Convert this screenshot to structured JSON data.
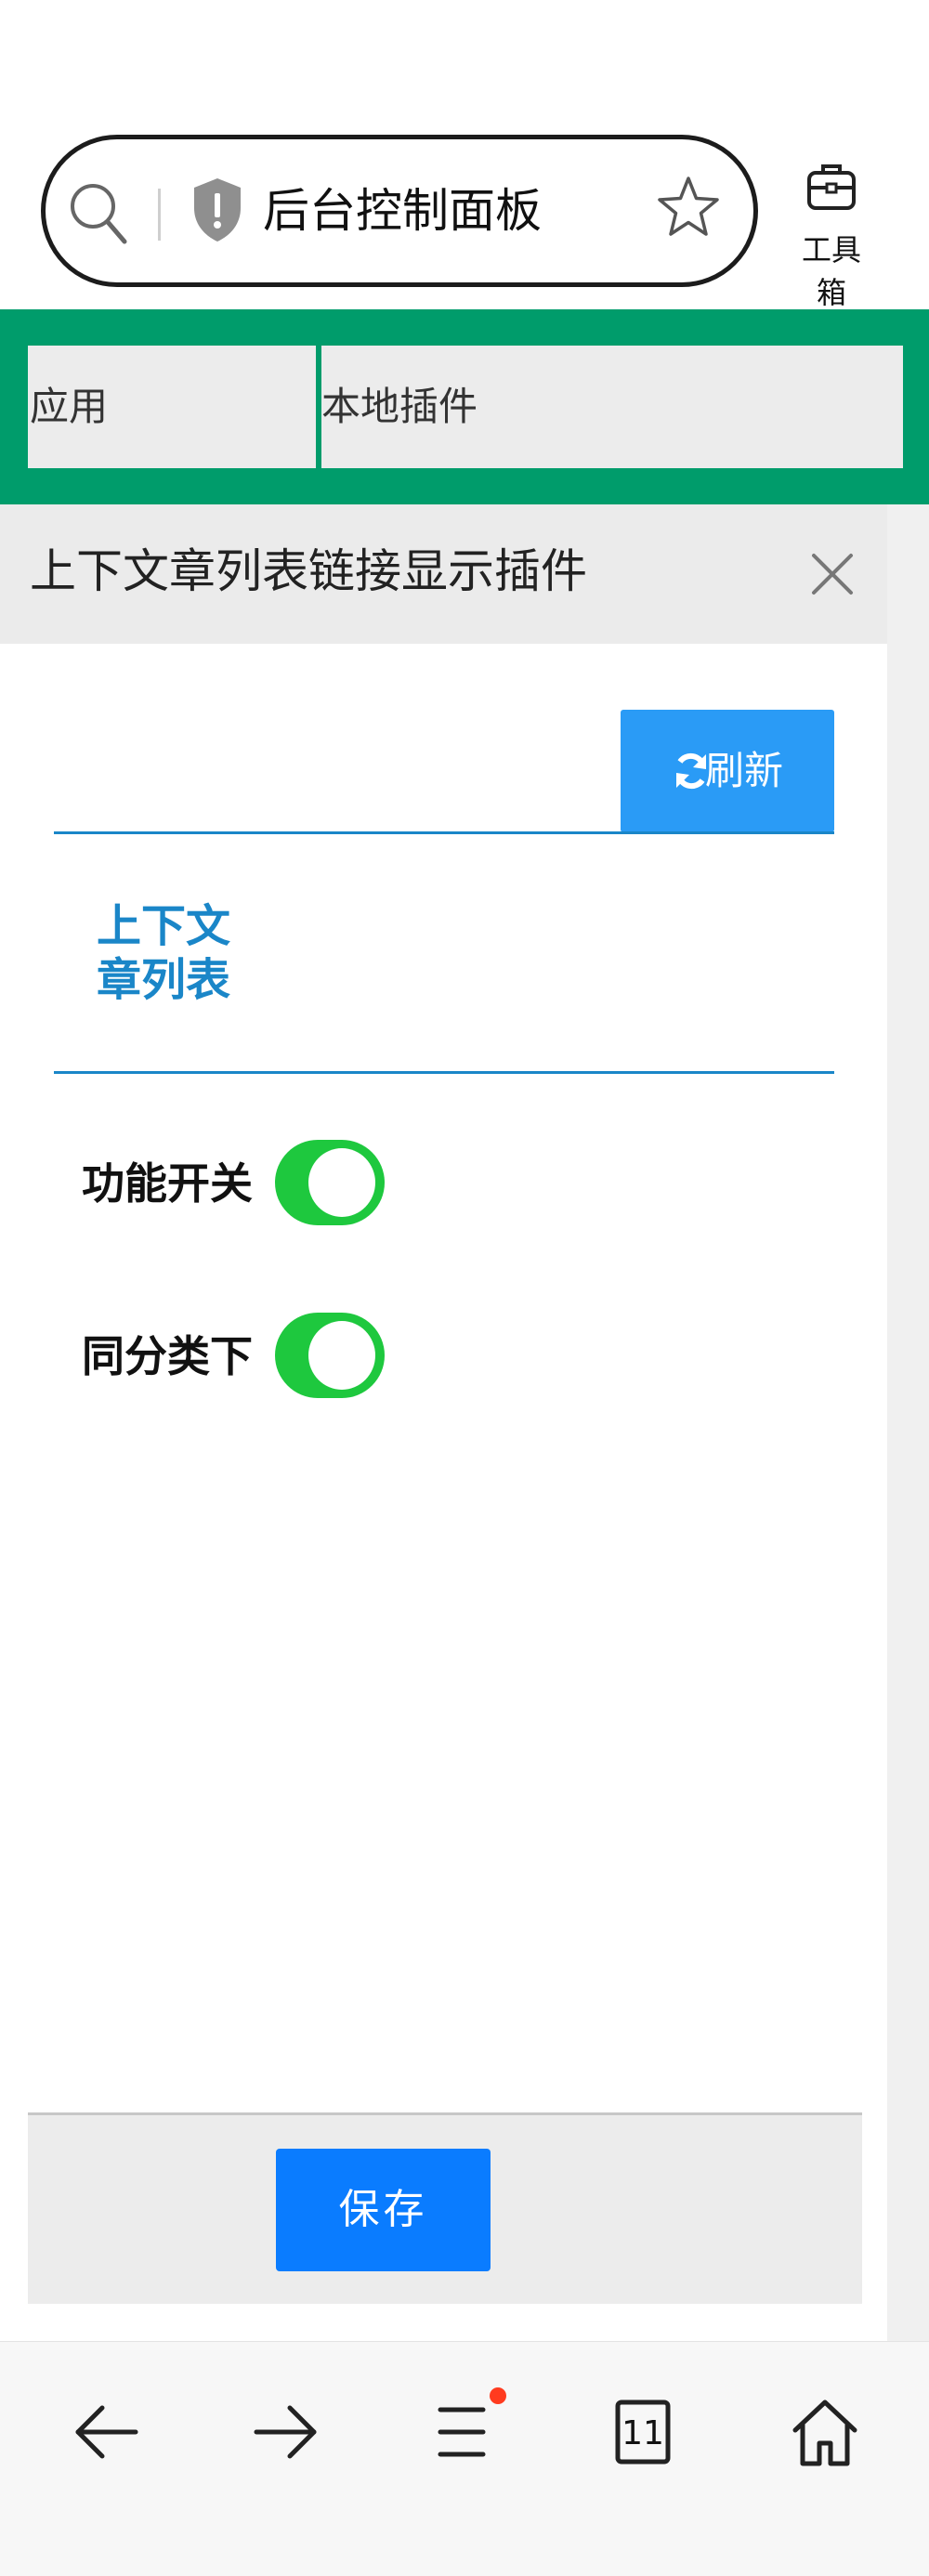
{
  "browser": {
    "url_title": "后台控制面板",
    "toolbox_label": "工具箱"
  },
  "nav": {
    "tabs": [
      {
        "label": "应用"
      },
      {
        "label": "本地插件"
      }
    ],
    "accent_color": "#009c6b"
  },
  "panel": {
    "title": "上下文章列表链接显示插件",
    "refresh_label": "刷新",
    "section_heading": "上下文章列表",
    "toggles": [
      {
        "label": "功能开关",
        "on": true
      },
      {
        "label": "同分类下",
        "on": true
      }
    ],
    "save_label": "保存"
  },
  "bottom_nav": {
    "tabs_count": "11",
    "menu_has_notification": true
  },
  "colors": {
    "primary_blue": "#0a7cff",
    "refresh_blue": "#2a9bf6",
    "heading_blue": "#1a86c8",
    "toggle_green": "#1ec83e"
  }
}
